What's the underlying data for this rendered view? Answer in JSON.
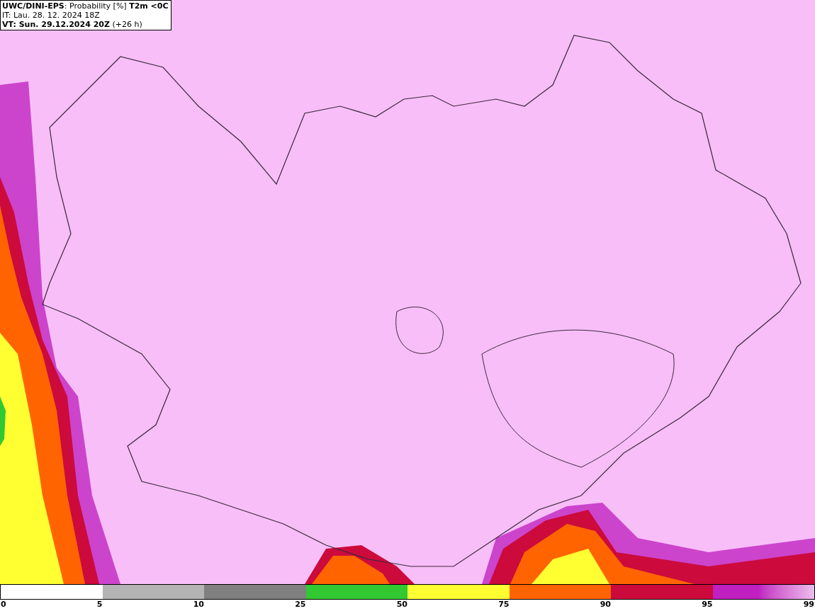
{
  "header": {
    "title": "**UWC/DINI-EPS**: Probability [%] **T2m <0C**",
    "init_time": "IT: Lau. 28. 12. 2024 18Z",
    "valid_time": "**VT: Sun. 29.12.2024 20Z** (+26 h)"
  },
  "legend": {
    "segments": [
      {
        "kind": "empty"
      },
      {
        "color": "#b4b4b4"
      },
      {
        "color": "#808080"
      },
      {
        "color": "#32c832"
      },
      {
        "color": "#ffff32"
      },
      {
        "color": "#ff6400"
      },
      {
        "color": "#cc0a3c"
      },
      {
        "kind": "gradient",
        "color": "#c020c0"
      }
    ],
    "labels": [
      "0",
      "5",
      "10",
      "25",
      "50",
      "75",
      "90",
      "95",
      "99"
    ]
  }
}
